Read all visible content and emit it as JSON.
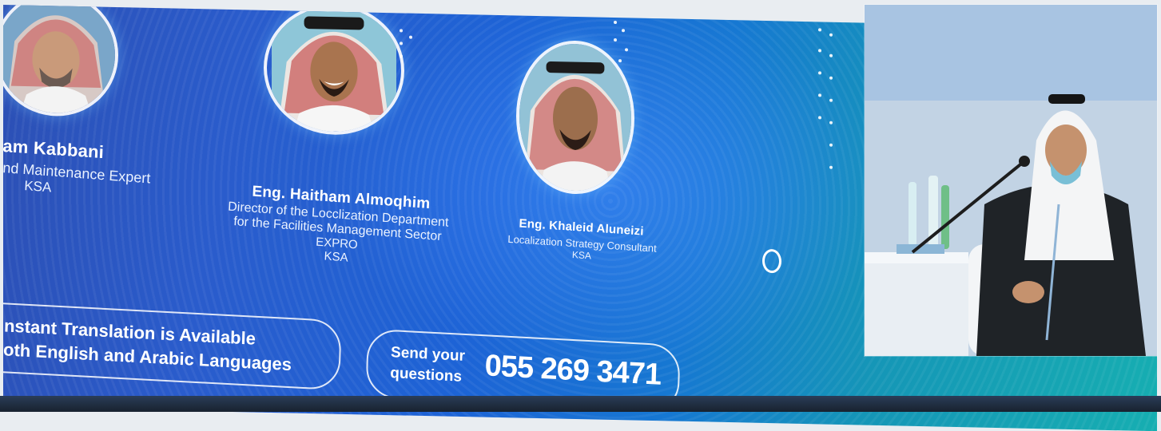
{
  "speakers": [
    {
      "name": "am Kabbani",
      "role_lines": [
        "nd Maintenance Expert",
        "KSA"
      ]
    },
    {
      "name": "Eng. Haitham Almoqhim",
      "role_lines": [
        "Director of the Locclization Department",
        "for the Facilities Management Sector",
        "EXPRO",
        "KSA"
      ]
    },
    {
      "name": "Eng. Khaleid Aluneizi",
      "role_lines": [
        "Localization Strategy Consultant",
        "KSA"
      ]
    }
  ],
  "translation_notice": {
    "line1": "nstant Translation is Available",
    "line2": "oth English and Arabic Languages"
  },
  "questions": {
    "label_line1": "Send your",
    "label_line2": "questions",
    "phone": "055 269 3471"
  },
  "colors": {
    "screen_blue": "#2a5ccc",
    "screen_teal": "#16aeb1",
    "text": "#ffffff"
  }
}
